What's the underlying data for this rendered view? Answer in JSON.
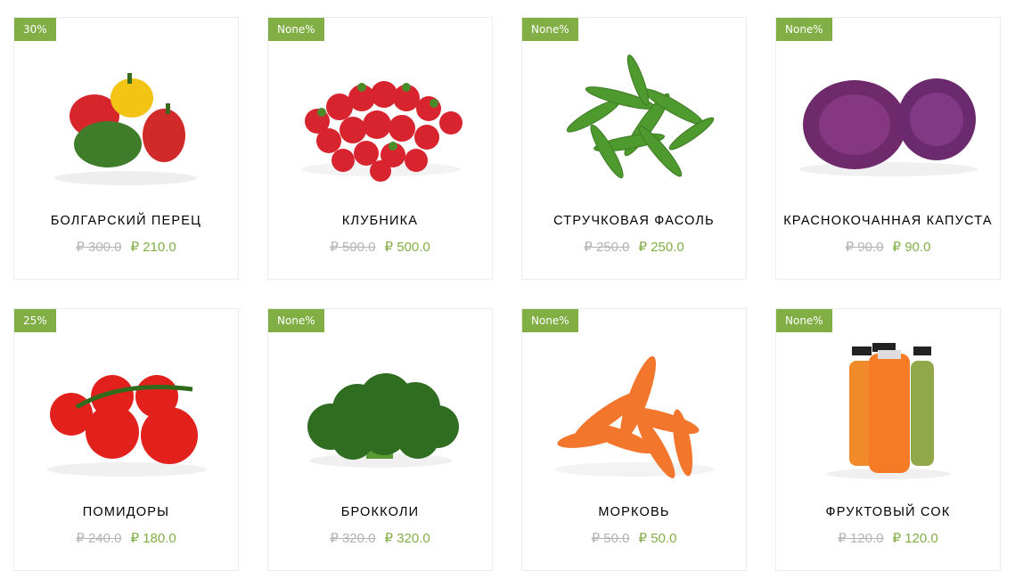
{
  "currency_symbol": "₽",
  "colors": {
    "accent": "#82ae46",
    "old_price": "#b3b3b3",
    "border": "#ececec"
  },
  "products": [
    {
      "name": "БОЛГАРСКИЙ ПЕРЕЦ",
      "badge": "30%",
      "old_price": "₽ 300.0",
      "new_price": "₽ 210.0",
      "image": "bell-peppers-image"
    },
    {
      "name": "КЛУБНИКА",
      "badge": "None%",
      "old_price": "₽ 500.0",
      "new_price": "₽ 500.0",
      "image": "strawberries-image"
    },
    {
      "name": "СТРУЧКОВАЯ ФАСОЛЬ",
      "badge": "None%",
      "old_price": "₽ 250.0",
      "new_price": "₽ 250.0",
      "image": "green-beans-image"
    },
    {
      "name": "КРАСНОКОЧАННАЯ КАПУСТА",
      "badge": "None%",
      "old_price": "₽ 90.0",
      "new_price": "₽ 90.0",
      "image": "red-cabbage-image"
    },
    {
      "name": "ПОМИДОРЫ",
      "badge": "25%",
      "old_price": "₽ 240.0",
      "new_price": "₽ 180.0",
      "image": "tomatoes-image"
    },
    {
      "name": "БРОККОЛИ",
      "badge": "None%",
      "old_price": "₽ 320.0",
      "new_price": "₽ 320.0",
      "image": "broccoli-image"
    },
    {
      "name": "МОРКОВЬ",
      "badge": "None%",
      "old_price": "₽ 50.0",
      "new_price": "₽ 50.0",
      "image": "carrots-image"
    },
    {
      "name": "ФРУКТОВЫЙ СОК",
      "badge": "None%",
      "old_price": "₽ 120.0",
      "new_price": "₽ 120.0",
      "image": "fruit-juice-image"
    }
  ]
}
